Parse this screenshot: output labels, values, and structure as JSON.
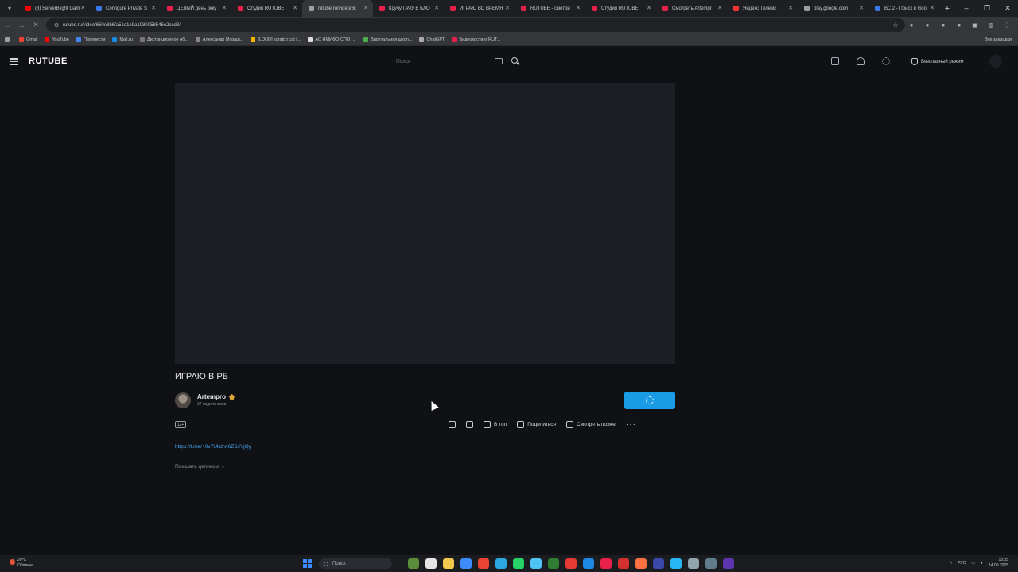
{
  "browser": {
    "tabs": [
      {
        "label": "(3) ServerBlight Gam",
        "color": "#ff0000"
      },
      {
        "label": "Configure Private S",
        "color": "#3b78e7"
      },
      {
        "label": "ЦЕЛЫЙ день окку",
        "color": "#e8214b"
      },
      {
        "label": "Студия RUTUBE",
        "color": "#e8214b"
      },
      {
        "label": "rutube.ru/video/60",
        "color": "#9aa0a6",
        "active": true
      },
      {
        "label": "Кручу ГАЧУ В БЛО",
        "color": "#e8214b"
      },
      {
        "label": "ИГРАЮ ВО ВРЕМЯ",
        "color": "#e8214b"
      },
      {
        "label": "RUTUBE - смотри",
        "color": "#e8214b"
      },
      {
        "label": "Студия RUTUBE",
        "color": "#e8214b"
      },
      {
        "label": "Смотреть Artempr",
        "color": "#e8214b"
      },
      {
        "label": "Яндекс Телемс",
        "color": "#f33"
      },
      {
        "label": "play.google.com",
        "color": "#9aa0a6"
      },
      {
        "label": "ВС 2 - Поиск в Goo",
        "color": "#3b78e7"
      }
    ],
    "url": "rutube.ru/video/660e8b6fa51d1e9a1980058546e2ccd3/",
    "bookmarks": [
      {
        "label": "Gmail",
        "color": "#ea4335"
      },
      {
        "label": "YouTube",
        "color": "#ff0000"
      },
      {
        "label": "Перевести",
        "color": "#4285f4"
      },
      {
        "label": "Mail.ru",
        "color": "#168de2"
      },
      {
        "label": "Дистанционное об...",
        "color": "#777"
      },
      {
        "label": "Александр Мураш...",
        "color": "#888"
      },
      {
        "label": "[LOUD] scratch cat f...",
        "color": "#f4b400"
      },
      {
        "label": "АС НМИФО СПО -...",
        "color": "#ddd"
      },
      {
        "label": "Виртуальная школ...",
        "color": "#4caf50"
      },
      {
        "label": "ChatGPT",
        "color": "#aaa"
      },
      {
        "label": "Видеохостинг RUT...",
        "color": "#e8214b"
      }
    ],
    "all_bookmarks": "Все закладки"
  },
  "header": {
    "logo": "RUTUBE",
    "search_placeholder": "Поиск",
    "safe_mode": "Безопасный режим"
  },
  "video": {
    "title": "ИГРАЮ В РБ",
    "channel": "Artempro",
    "subscribers": "37 подписчиков",
    "age_rating": "12+",
    "actions": {
      "top": "В топ",
      "share": "Поделиться",
      "watch_later": "Смотреть позже"
    },
    "description_link": "https://t.me/+0v7Ukdrw6ZSJYjQy",
    "show_more": "Показать целиком"
  },
  "taskbar": {
    "weather_temp": "20°C",
    "weather_desc": "Облачно",
    "search_label": "Поиск",
    "lang": "РУС",
    "time": "15:05",
    "date": "14.09.2025",
    "apps": [
      "#5b8c3a",
      "#e5e5e5",
      "#f2c94c",
      "#3d8bfd",
      "#ea4335",
      "#2ca5e0",
      "#25d366",
      "#4fc3f7",
      "#2e7d32",
      "#e53935",
      "#1e88e5",
      "#e8214b",
      "#d32f2f",
      "#ff7043",
      "#3949ab",
      "#29b6f6",
      "#90a4ae",
      "#607d8b",
      "#5e35b1"
    ]
  }
}
